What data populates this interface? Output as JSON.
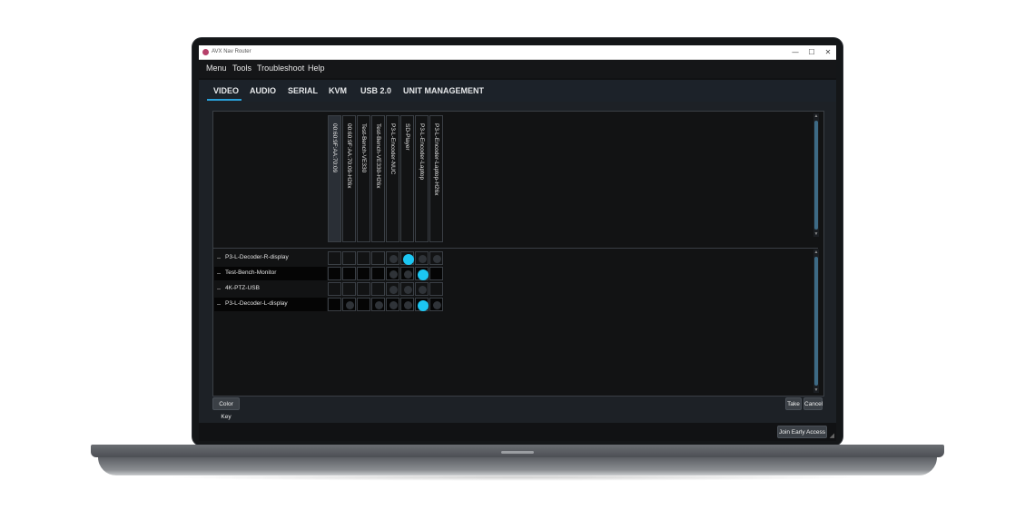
{
  "window": {
    "title": "AVX Nav Router",
    "minimize": "—",
    "maximize": "☐",
    "close": "✕"
  },
  "menu": [
    "Menu",
    "Tools",
    "Troubleshoot",
    "Help"
  ],
  "tabs": [
    "VIDEO",
    "AUDIO",
    "SERIAL",
    "KVM",
    "USB 2.0",
    "UNIT MANAGEMENT"
  ],
  "active_tab": "VIDEO",
  "columns": [
    "00:60:9F:AA:70:09",
    "00:60:9F:AA:70:09-H26x",
    "Test-Bench-VE330",
    "Test-Bench-VE330-H26x",
    "P3-L-Encoder-NUC",
    "SD-Player",
    "P3-L-Encoder-Laptop",
    "P3-L-Encoder-Laptop-H26x"
  ],
  "rows": [
    {
      "label": "P3-L-Decoder-R-display",
      "cells": [
        "none",
        "none",
        "none",
        "none",
        "off",
        "on",
        "off",
        "off"
      ]
    },
    {
      "label": "Test-Bench-Monitor",
      "cells": [
        "none",
        "none",
        "none",
        "none",
        "off",
        "off",
        "on",
        "none"
      ]
    },
    {
      "label": "4K-PTZ-USB",
      "cells": [
        "none",
        "none",
        "none",
        "none",
        "off",
        "off",
        "off",
        "none"
      ]
    },
    {
      "label": "P3-L-Decoder-L-display",
      "cells": [
        "none",
        "off",
        "none",
        "off",
        "off",
        "off",
        "on",
        "off"
      ]
    }
  ],
  "buttons": {
    "color_key": "Color Key",
    "take": "Take",
    "cancel": "Cancel",
    "join_early_access": "Join Early Access"
  },
  "colors": {
    "active_route": "#1cc6f2",
    "inactive_route": "#2f3338",
    "tab_underline": "#2aa0d8"
  }
}
